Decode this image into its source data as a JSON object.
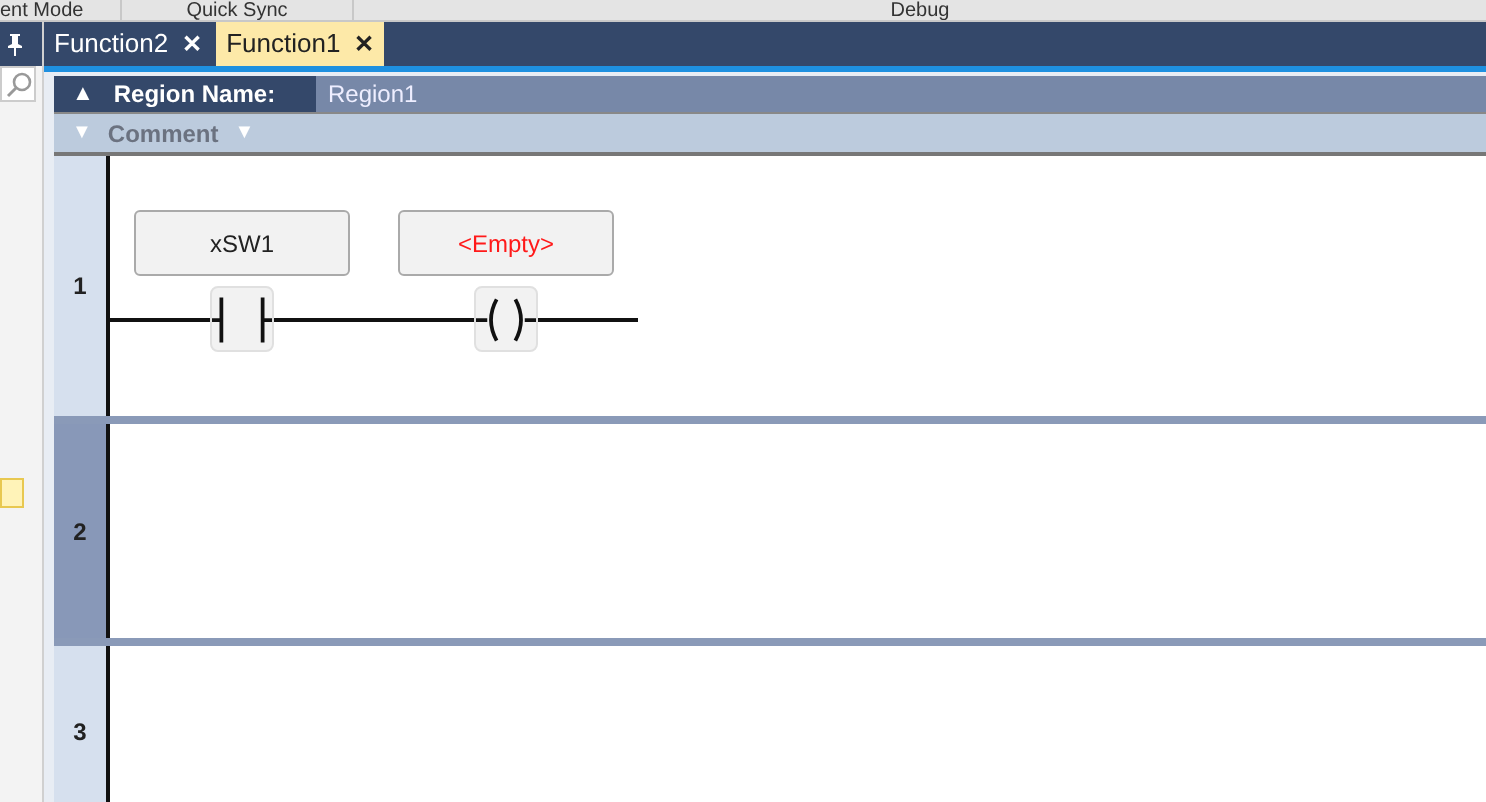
{
  "toolbar": [
    "ent Mode",
    "Quick Sync",
    "Debug"
  ],
  "tabs": [
    {
      "label": "Function2",
      "close": "✕",
      "selected": false
    },
    {
      "label": "Function1",
      "close": "✕",
      "selected": true
    }
  ],
  "region": {
    "toggle": "▲",
    "label": "Region Name:",
    "value": "Region1"
  },
  "comment": {
    "toggle": "▼",
    "label": "Comment",
    "menu": "▼"
  },
  "rungs": [
    {
      "number": "1",
      "selected": false,
      "elements": [
        {
          "kind": "contact",
          "variable": "xSW1",
          "empty": false
        },
        {
          "kind": "coil",
          "variable": "<Empty>",
          "empty": true
        }
      ]
    },
    {
      "number": "2",
      "selected": true
    },
    {
      "number": "3",
      "selected": false
    }
  ]
}
